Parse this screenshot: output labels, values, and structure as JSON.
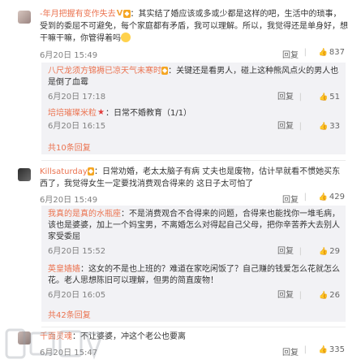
{
  "comments": [
    {
      "user": "-年月把握有变作失去",
      "badge_v": "V",
      "body": "：其实结了婚应该或多或少都是这样的吧，生活中的琐事，受到的委屈不可避免，每个家庭都有矛盾，我可以理解。所以，我觉得还是单身好，想干嘛干嘛，你管得着吗",
      "time": "6月20日 15:49",
      "reply": "回复",
      "likes": "837",
      "subreplies": [
        {
          "user": "八尺龙须方锦褥已凉天气未寒时",
          "text": "：关键还是看男人，碰上这种熊风点火的男人也是倒了血霉",
          "time": "6月20日 17:18",
          "reply": "回复",
          "likes": "51"
        },
        {
          "user": "培培璀璨米粒",
          "star": "★",
          "text": "：日常不婚教育（1/1）",
          "time": "6月20日 16:15",
          "reply": "回复",
          "likes": "33"
        }
      ],
      "more": "共10条回复"
    },
    {
      "user": "Killsaturday",
      "body": "：日常劝婚，老太太脑子有病 丈夫也是废物，估计早就看不惯她买东西了，我觉得女生一定要找消费观合得来的 这日子太可怕了",
      "time": "6月20日 15:49",
      "reply": "回复",
      "likes": "429",
      "subreplies": [
        {
          "user": "我真的是真的水瓶座",
          "text": "：不是消费观合不合得来的问题，合得来也能找你一堆毛病，该也是婆婆，加上一个妈宝男，不离婚怎么对得起自己父母，把你辛苦养大去别人家受委屈",
          "time": "6月20日 15:52",
          "reply": "回复",
          "likes": "29"
        },
        {
          "user": "英皇嫱嫱",
          "text": "：这女的不是也上班的？难道在家吃闲饭了？自己赚的钱爱怎么花就怎么花。老人思想陈旧可以理解，但男的简直废物！",
          "time": "6月20日 16:05",
          "reply": "回复",
          "likes": "26"
        }
      ],
      "more": "共42条回复"
    },
    {
      "user": "千面灵魂",
      "body": "：不让婆婆，冲这个老公也要离",
      "time": "6月20日 15:47",
      "reply": "回复",
      "likes": "335"
    }
  ],
  "icons": {
    "thumb": "thumbs-up-icon",
    "emoji": "smile-emoji-icon",
    "badge": "member-badge-icon"
  },
  "colors": {
    "username": "#eb7350",
    "subbox": "#f2f2f5",
    "meta": "#808080"
  }
}
